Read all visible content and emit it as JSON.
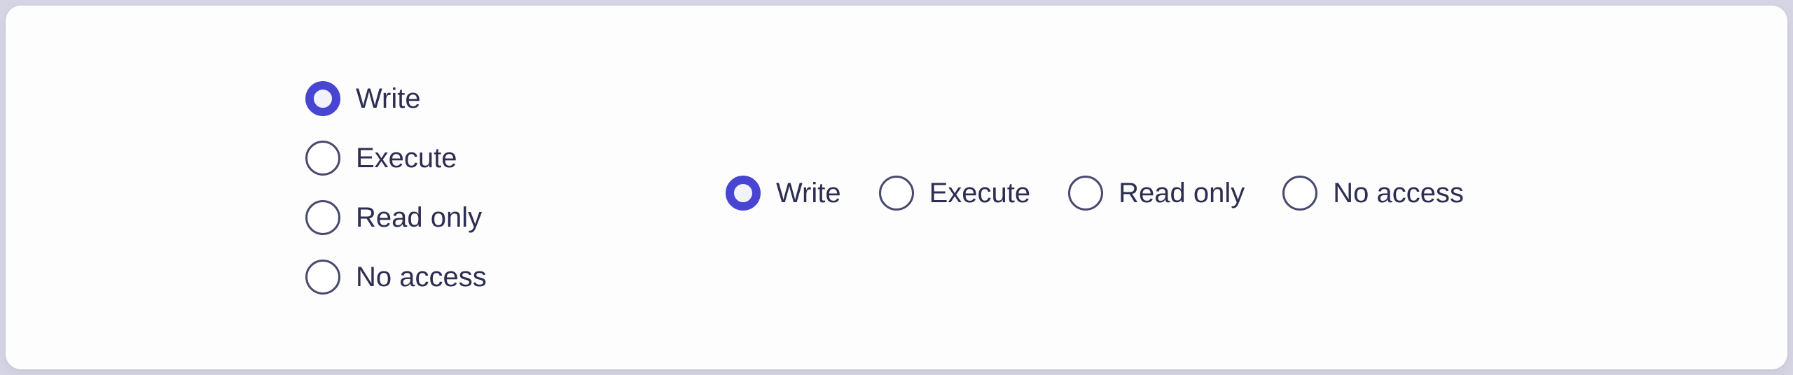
{
  "theme": {
    "page_background": "#d6d5e4",
    "card_background": "#fdfdfd",
    "accent_selected": "#4845d2",
    "accent_selected_inner": "#f2f2fa",
    "radio_border_unselected": "#4a4a6e",
    "label_text": "#2e2e52"
  },
  "groups": [
    {
      "name": "permissions-vertical",
      "orientation": "vertical",
      "selected_value": "Write",
      "options": [
        {
          "label": "Write",
          "selected": true
        },
        {
          "label": "Execute",
          "selected": false
        },
        {
          "label": "Read only",
          "selected": false
        },
        {
          "label": "No access",
          "selected": false
        }
      ]
    },
    {
      "name": "permissions-horizontal",
      "orientation": "horizontal",
      "selected_value": "Write",
      "options": [
        {
          "label": "Write",
          "selected": true
        },
        {
          "label": "Execute",
          "selected": false
        },
        {
          "label": "Read only",
          "selected": false
        },
        {
          "label": "No access",
          "selected": false
        }
      ]
    }
  ]
}
